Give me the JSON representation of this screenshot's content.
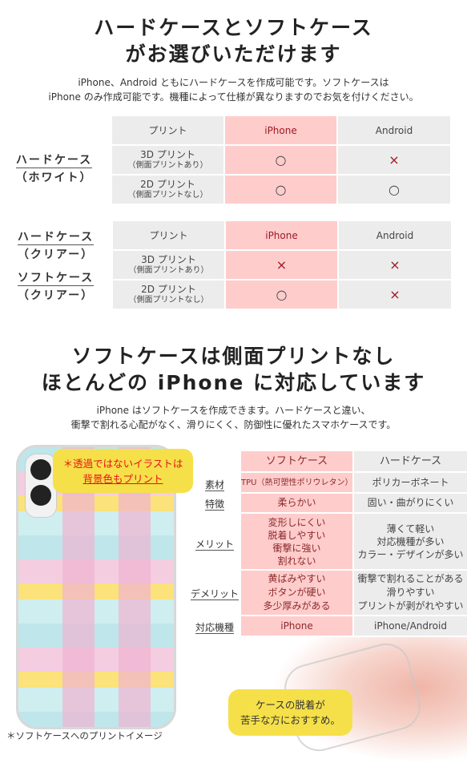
{
  "section1": {
    "title_lines": [
      "ハードケースとソフトケース",
      "がお選びいただけます"
    ],
    "desc_lines": [
      "iPhone、Android ともにハードケースを作成可能です。ソフトケースは",
      "iPhone のみ作成可能です。機種によって仕様が異なりますのでお気を付けください。"
    ]
  },
  "table1": {
    "label": [
      "ハードケース",
      "（ホワイト）"
    ],
    "headers": [
      "プリント",
      "iPhone",
      "Android"
    ],
    "rows": [
      {
        "print": "3D プリント",
        "note": "（側面プリントあり）",
        "iphone": "○",
        "android": "×"
      },
      {
        "print": "2D プリント",
        "note": "（側面プリントなし）",
        "iphone": "○",
        "android": "○"
      }
    ]
  },
  "table2": {
    "label": [
      "ハードケース",
      "（クリアー）",
      "ソフトケース",
      "（クリアー）"
    ],
    "headers": [
      "プリント",
      "iPhone",
      "Android"
    ],
    "rows": [
      {
        "print": "3D プリント",
        "note": "（側面プリントあり）",
        "iphone": "×",
        "android": "×"
      },
      {
        "print": "2D プリント",
        "note": "（側面プリントなし）",
        "iphone": "○",
        "android": "×"
      }
    ]
  },
  "section2": {
    "title_lines": [
      "ソフトケースは側面プリントなし",
      "ほとんどの iPhone に対応しています"
    ],
    "desc_lines": [
      "iPhone はソフトケースを作成できます。ハードケースと違い、",
      "衝撃で割れる心配がなく、滑りにくく、防御性に優れたスマホケースです。"
    ]
  },
  "phone": {
    "callout_lines": [
      "＊透過ではないイラストは",
      "背景色もプリント"
    ],
    "caption": "＊ソフトケースへのプリントイメージ"
  },
  "table3": {
    "headers": [
      "ソフトケース",
      "ハードケース"
    ],
    "rows": [
      {
        "label": "素材",
        "soft": [
          "TPU（熱可塑性ポリウレタン）"
        ],
        "hard": [
          "ポリカーボネート"
        ]
      },
      {
        "label": "特徴",
        "soft": [
          "柔らかい"
        ],
        "hard": [
          "固い・曲がりにくい"
        ]
      },
      {
        "label": "メリット",
        "soft": [
          "変形しにくい",
          "脱着しやすい",
          "衝撃に強い",
          "割れない"
        ],
        "hard": [
          "薄くて軽い",
          "対応機種が多い",
          "カラー・デザインが多い"
        ]
      },
      {
        "label": "デメリット",
        "soft": [
          "黄ばみやすい",
          "ボタンが硬い",
          "多少厚みがある"
        ],
        "hard": [
          "衝撃で割れることがある",
          "滑りやすい",
          "プリントが剥がれやすい"
        ]
      },
      {
        "label": "対応機種",
        "soft": [
          "iPhone"
        ],
        "hard": [
          "iPhone/Android"
        ]
      }
    ]
  },
  "hand": {
    "callout_lines": [
      "ケースの脱着が",
      "苦手な方におすすめ。"
    ]
  },
  "colors": {
    "pink": "#ffcccc",
    "gray": "#ececec",
    "red": "#a01822",
    "yellow": "#f5e04a"
  }
}
